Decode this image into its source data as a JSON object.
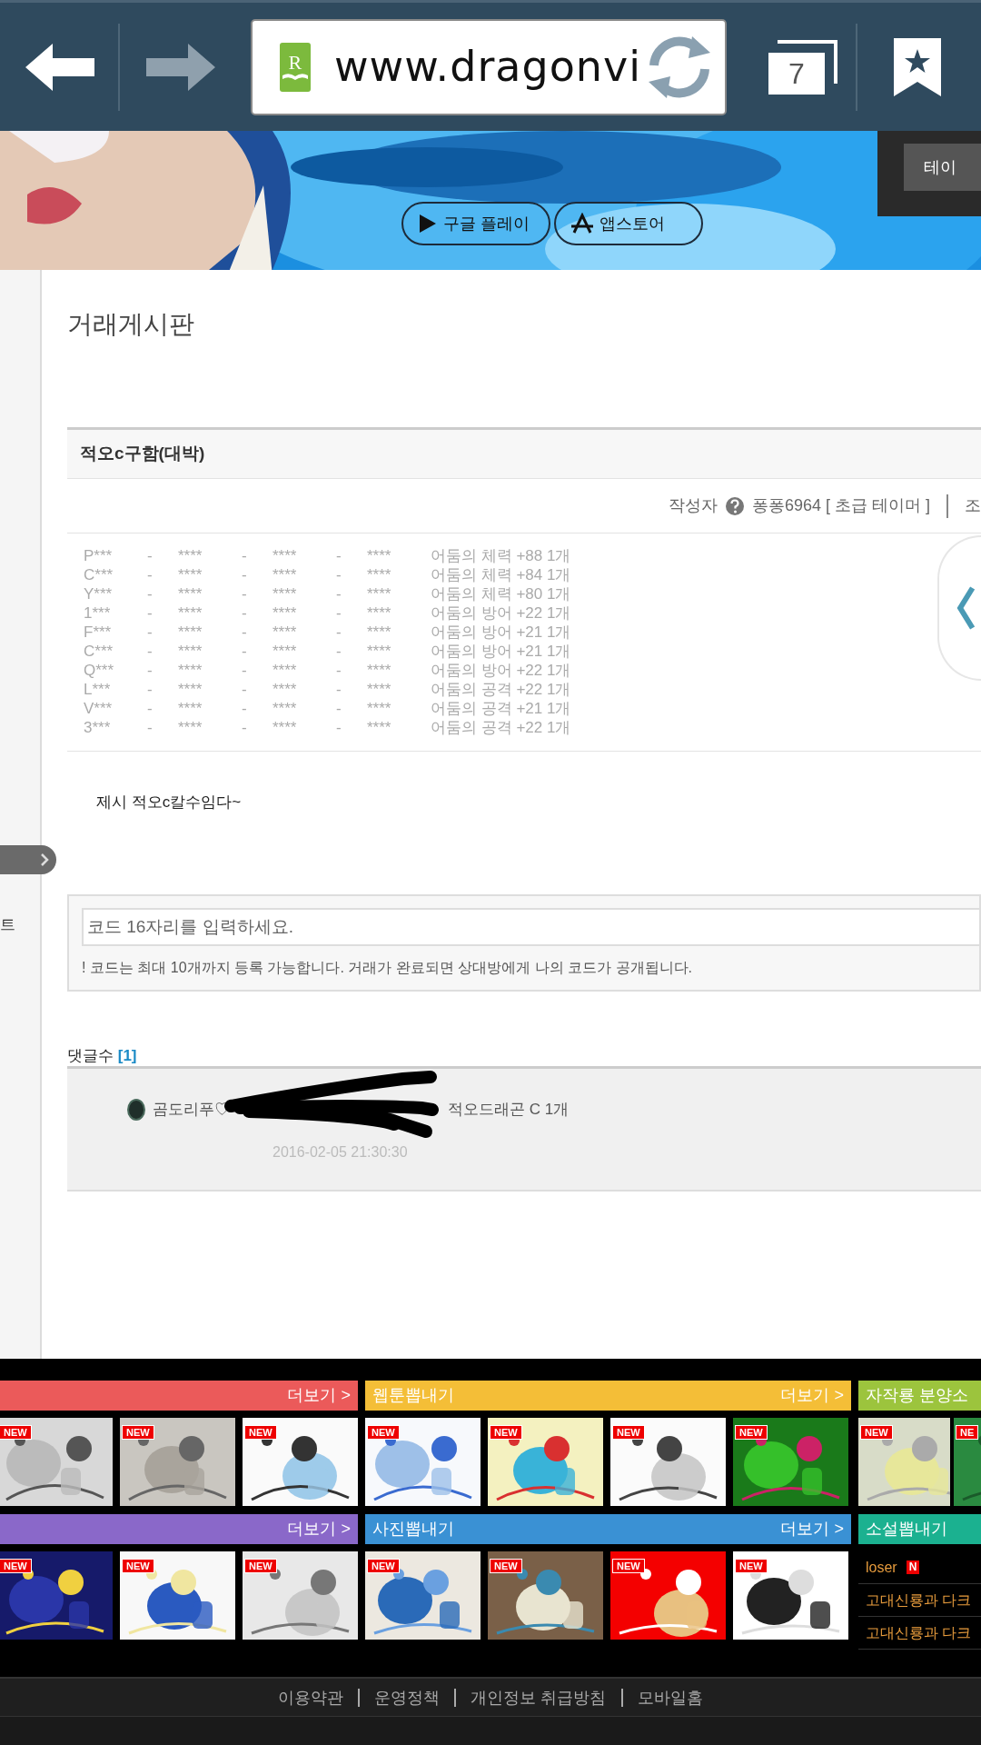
{
  "browser": {
    "back": {
      "disabled": false
    },
    "forward": {
      "disabled": true
    },
    "site_logo": "R",
    "url": "www.dragonvi",
    "tab_count": "7"
  },
  "banner": {
    "kind": "picture",
    "buttons": [
      "구글 플레이",
      "앱스토어"
    ],
    "panel_button": "테이"
  },
  "sidebar": {
    "label": "트",
    "expanded": false
  },
  "board_title": "거래게시판",
  "post": {
    "title": "적오c구함(대박)",
    "author_label": "작성자",
    "author": "퐁퐁6964 [ 초급 테이머 ]",
    "meta_cut": "조",
    "lines": [
      {
        "cells": [
          "P***",
          "-",
          "****",
          "-",
          "****",
          "-",
          "****",
          "어둠의 체력 +88 1개"
        ]
      },
      {
        "cells": [
          "C***",
          "-",
          "****",
          "-",
          "****",
          "-",
          "****",
          "어둠의 체력 +84 1개"
        ]
      },
      {
        "cells": [
          "Y***",
          "-",
          "****",
          "-",
          "****",
          "-",
          "****",
          "어둠의 체력 +80 1개"
        ]
      },
      {
        "cells": [
          "1***",
          "-",
          "****",
          "-",
          "****",
          "-",
          "****",
          "어둠의 방어 +22 1개"
        ]
      },
      {
        "cells": [
          "F***",
          "-",
          "****",
          "-",
          "****",
          "-",
          "****",
          "어둠의 방어 +21 1개"
        ]
      },
      {
        "cells": [
          "C***",
          "-",
          "****",
          "-",
          "****",
          "-",
          "****",
          "어둠의 방어 +21 1개"
        ]
      },
      {
        "cells": [
          "Q***",
          "-",
          "****",
          "-",
          "****",
          "-",
          "****",
          "어둠의 방어 +22 1개"
        ]
      },
      {
        "cells": [
          "L***",
          "-",
          "****",
          "-",
          "****",
          "-",
          "****",
          "어둠의 공격 +22 1개"
        ]
      },
      {
        "cells": [
          "V***",
          "-",
          "****",
          "-",
          "****",
          "-",
          "****",
          "어둠의 공격 +21 1개"
        ]
      },
      {
        "cells": [
          "3***",
          "-",
          "****",
          "-",
          "****",
          "-",
          "****",
          "어둠의 공격 +22 1개"
        ]
      }
    ],
    "body": "제시 적오c칼수임다~"
  },
  "code_entry": {
    "placeholder": "코드 16자리를 입력하세요.",
    "note": "! 코드는 최대 10개까지 등록 가능합니다. 거래가 완료되면 상대방에게 나의 코드가 공개됩니다."
  },
  "comments": {
    "label": "댓글수",
    "count": "[1]",
    "items": [
      {
        "author": "곰도리푸♡",
        "text": "적오드래곤 C 1개",
        "date": "2016-02-05 21:30:30"
      }
    ]
  },
  "gallery": [
    {
      "kind": "thumbnails",
      "color": "#eb5a5a",
      "more": "더보기 >",
      "thumbnails": [
        {
          "badge": "NEW"
        },
        {
          "badge": "NEW"
        },
        {
          "badge": "NEW"
        }
      ]
    },
    {
      "kind": "thumbnails",
      "color": "#f4be37",
      "title": "웹툰뽑내기",
      "more": "더보기 >",
      "thumbnails": [
        {
          "badge": "NEW"
        },
        {
          "badge": "NEW"
        },
        {
          "badge": "NEW"
        },
        {
          "badge": "NEW"
        }
      ]
    },
    {
      "kind": "thumbnails",
      "color": "#9cc43d",
      "title": "자작룡 분양소",
      "thumbnails": [
        {
          "badge": "NEW"
        },
        {
          "badge": "NE"
        }
      ]
    },
    {
      "kind": "thumbnails",
      "color": "#8a68c9",
      "more": "더보기 >",
      "thumbnails": [
        {
          "badge": "NEW"
        },
        {
          "badge": "NEW"
        },
        {
          "badge": "NEW"
        }
      ]
    },
    {
      "kind": "thumbnails",
      "color": "#3a91d4",
      "title": "사진뽑내기",
      "more": "더보기 >",
      "thumbnails": [
        {
          "badge": "NEW"
        },
        {
          "badge": "NEW"
        },
        {
          "badge": "NEW"
        },
        {
          "badge": "NEW"
        }
      ]
    },
    {
      "kind": "list",
      "color": "#1bb190",
      "title": "소설뽑내기",
      "items": [
        {
          "title": "loser",
          "badge": "N"
        },
        {
          "title": "고대신룡과 다크"
        },
        {
          "title": "고대신룡과 다크"
        }
      ]
    }
  ],
  "footer_links": [
    "이용약관",
    "운영정책",
    "개인정보 취급방침",
    "모바일홈"
  ]
}
